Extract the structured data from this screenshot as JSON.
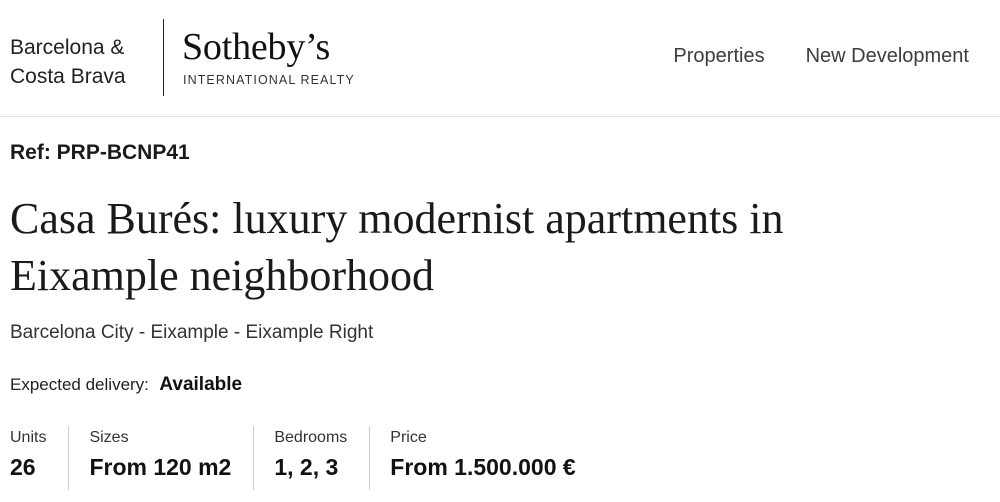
{
  "header": {
    "region_line1": "Barcelona &",
    "region_line2": "Costa Brava",
    "brand_name": "Sotheby’s",
    "brand_sub": "INTERNATIONAL REALTY",
    "nav": [
      {
        "label": "Properties"
      },
      {
        "label": "New Development"
      }
    ]
  },
  "listing": {
    "ref": "Ref: PRP-BCNP41",
    "title_line1": "Casa Burés: luxury modernist apartments in",
    "title_line2": "Eixample neighborhood",
    "location": "Barcelona City - Eixample - Eixample Right",
    "delivery_label": "Expected delivery:",
    "delivery_value": "Available"
  },
  "stats": [
    {
      "label": "Units",
      "value": "26"
    },
    {
      "label": "Sizes",
      "value": "From 120 m2"
    },
    {
      "label": "Bedrooms",
      "value": "1, 2, 3"
    },
    {
      "label": "Price",
      "value": "From 1.500.000 €"
    }
  ]
}
